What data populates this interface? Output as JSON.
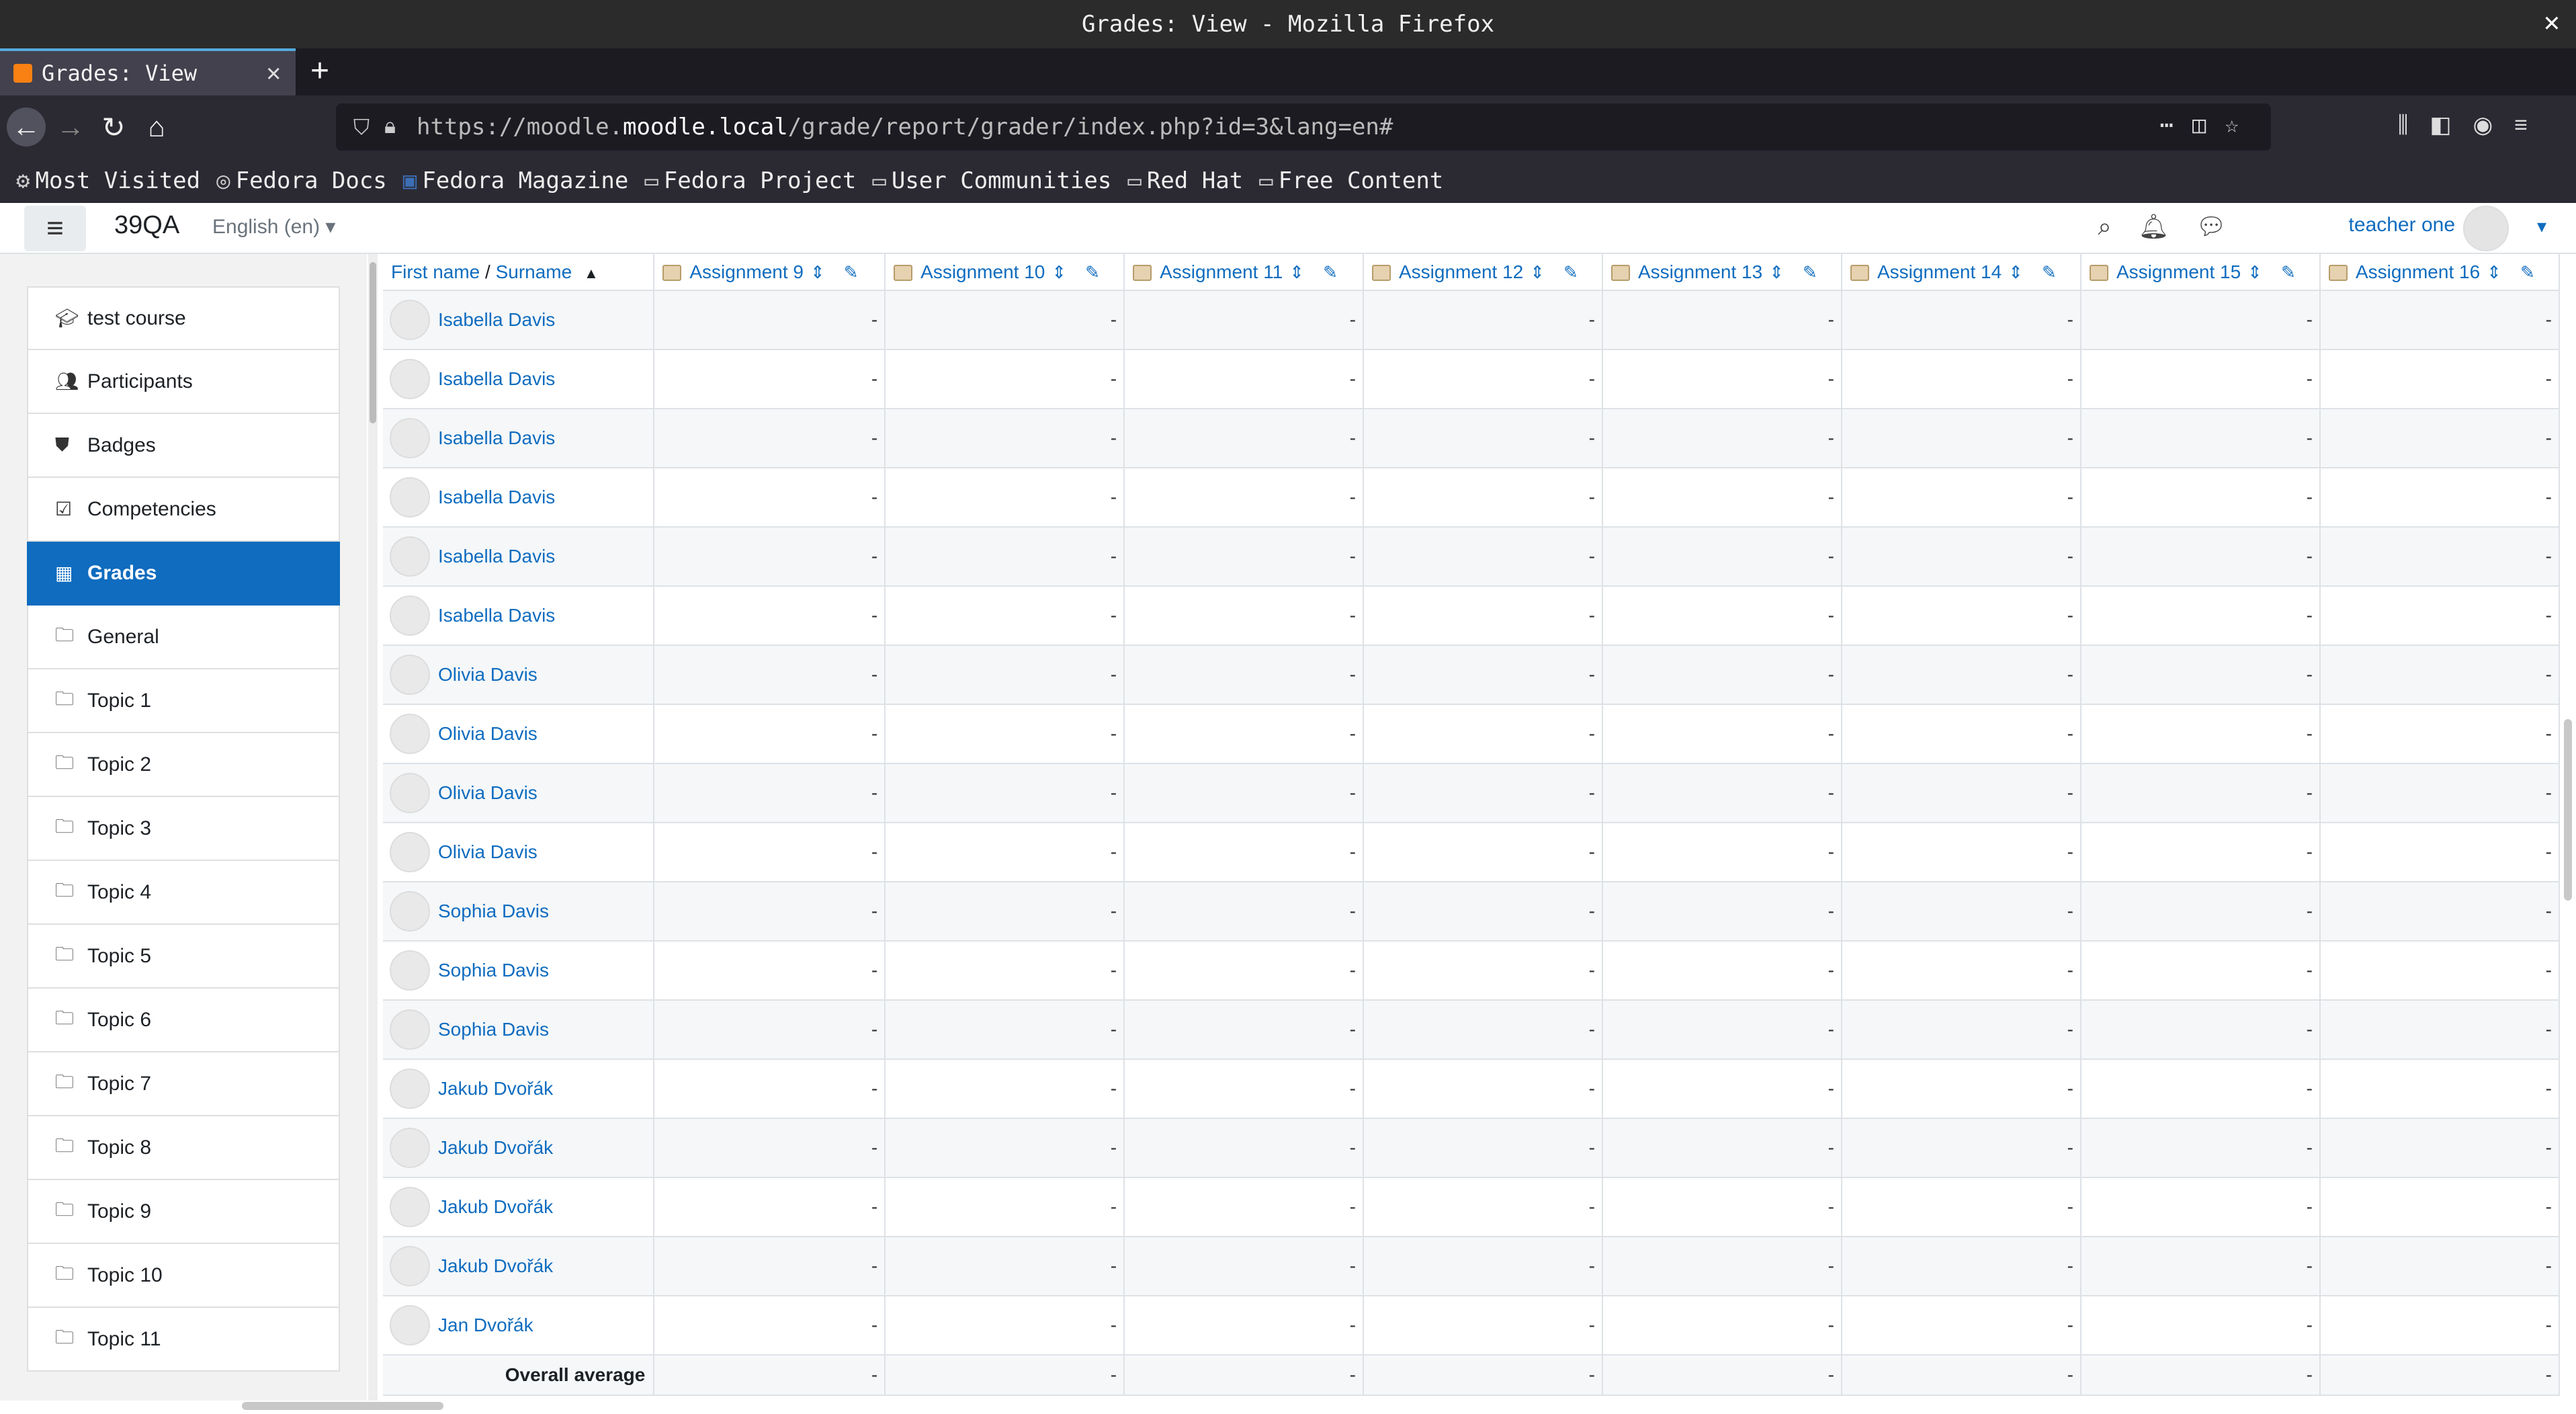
{
  "window": {
    "title": "Grades: View - Mozilla Firefox"
  },
  "browser": {
    "tab_title": "Grades: View",
    "url_prefix": "https://moodle.",
    "url_host": "moodle.local",
    "url_path": "/grade/report/grader/index.php?id=3&lang=en#",
    "bookmarks": [
      "Most Visited",
      "Fedora Docs",
      "Fedora Magazine",
      "Fedora Project",
      "User Communities",
      "Red Hat",
      "Free Content"
    ]
  },
  "header": {
    "site_name": "39QA",
    "language": "English (en)",
    "user": "teacher one"
  },
  "sidebar": {
    "items": [
      {
        "label": "test course",
        "icon": "graduation-cap-icon"
      },
      {
        "label": "Participants",
        "icon": "users-icon"
      },
      {
        "label": "Badges",
        "icon": "shield-icon"
      },
      {
        "label": "Competencies",
        "icon": "check-square-icon"
      },
      {
        "label": "Grades",
        "icon": "table-icon"
      },
      {
        "label": "General",
        "icon": "folder-icon"
      },
      {
        "label": "Topic 1",
        "icon": "folder-icon"
      },
      {
        "label": "Topic 2",
        "icon": "folder-icon"
      },
      {
        "label": "Topic 3",
        "icon": "folder-icon"
      },
      {
        "label": "Topic 4",
        "icon": "folder-icon"
      },
      {
        "label": "Topic 5",
        "icon": "folder-icon"
      },
      {
        "label": "Topic 6",
        "icon": "folder-icon"
      },
      {
        "label": "Topic 7",
        "icon": "folder-icon"
      },
      {
        "label": "Topic 8",
        "icon": "folder-icon"
      },
      {
        "label": "Topic 9",
        "icon": "folder-icon"
      },
      {
        "label": "Topic 10",
        "icon": "folder-icon"
      },
      {
        "label": "Topic 11",
        "icon": "folder-icon"
      }
    ],
    "active": "Grades"
  },
  "grades": {
    "name_header_first": "First name",
    "name_header_sep": " / ",
    "name_header_last": "Surname",
    "columns": [
      "Assignment 9",
      "Assignment 10",
      "Assignment 11",
      "Assignment 12",
      "Assignment 13",
      "Assignment 14",
      "Assignment 15",
      "Assignment 16"
    ],
    "rows": [
      {
        "name": "Isabella Davis",
        "grades": [
          "-",
          "-",
          "-",
          "-",
          "-",
          "-",
          "-",
          "-"
        ]
      },
      {
        "name": "Isabella Davis",
        "grades": [
          "-",
          "-",
          "-",
          "-",
          "-",
          "-",
          "-",
          "-"
        ]
      },
      {
        "name": "Isabella Davis",
        "grades": [
          "-",
          "-",
          "-",
          "-",
          "-",
          "-",
          "-",
          "-"
        ]
      },
      {
        "name": "Isabella Davis",
        "grades": [
          "-",
          "-",
          "-",
          "-",
          "-",
          "-",
          "-",
          "-"
        ]
      },
      {
        "name": "Isabella Davis",
        "grades": [
          "-",
          "-",
          "-",
          "-",
          "-",
          "-",
          "-",
          "-"
        ]
      },
      {
        "name": "Isabella Davis",
        "grades": [
          "-",
          "-",
          "-",
          "-",
          "-",
          "-",
          "-",
          "-"
        ]
      },
      {
        "name": "Olivia Davis",
        "grades": [
          "-",
          "-",
          "-",
          "-",
          "-",
          "-",
          "-",
          "-"
        ]
      },
      {
        "name": "Olivia Davis",
        "grades": [
          "-",
          "-",
          "-",
          "-",
          "-",
          "-",
          "-",
          "-"
        ]
      },
      {
        "name": "Olivia Davis",
        "grades": [
          "-",
          "-",
          "-",
          "-",
          "-",
          "-",
          "-",
          "-"
        ]
      },
      {
        "name": "Olivia Davis",
        "grades": [
          "-",
          "-",
          "-",
          "-",
          "-",
          "-",
          "-",
          "-"
        ]
      },
      {
        "name": "Sophia Davis",
        "grades": [
          "-",
          "-",
          "-",
          "-",
          "-",
          "-",
          "-",
          "-"
        ]
      },
      {
        "name": "Sophia Davis",
        "grades": [
          "-",
          "-",
          "-",
          "-",
          "-",
          "-",
          "-",
          "-"
        ]
      },
      {
        "name": "Sophia Davis",
        "grades": [
          "-",
          "-",
          "-",
          "-",
          "-",
          "-",
          "-",
          "-"
        ]
      },
      {
        "name": "Jakub Dvořák",
        "grades": [
          "-",
          "-",
          "-",
          "-",
          "-",
          "-",
          "-",
          "-"
        ]
      },
      {
        "name": "Jakub Dvořák",
        "grades": [
          "-",
          "-",
          "-",
          "-",
          "-",
          "-",
          "-",
          "-"
        ]
      },
      {
        "name": "Jakub Dvořák",
        "grades": [
          "-",
          "-",
          "-",
          "-",
          "-",
          "-",
          "-",
          "-"
        ]
      },
      {
        "name": "Jakub Dvořák",
        "grades": [
          "-",
          "-",
          "-",
          "-",
          "-",
          "-",
          "-",
          "-"
        ]
      },
      {
        "name": "Jan Dvořák",
        "grades": [
          "-",
          "-",
          "-",
          "-",
          "-",
          "-",
          "-",
          "-"
        ]
      }
    ],
    "overall_label": "Overall average",
    "overall": [
      "-",
      "-",
      "-",
      "-",
      "-",
      "-",
      "-",
      "-"
    ]
  }
}
